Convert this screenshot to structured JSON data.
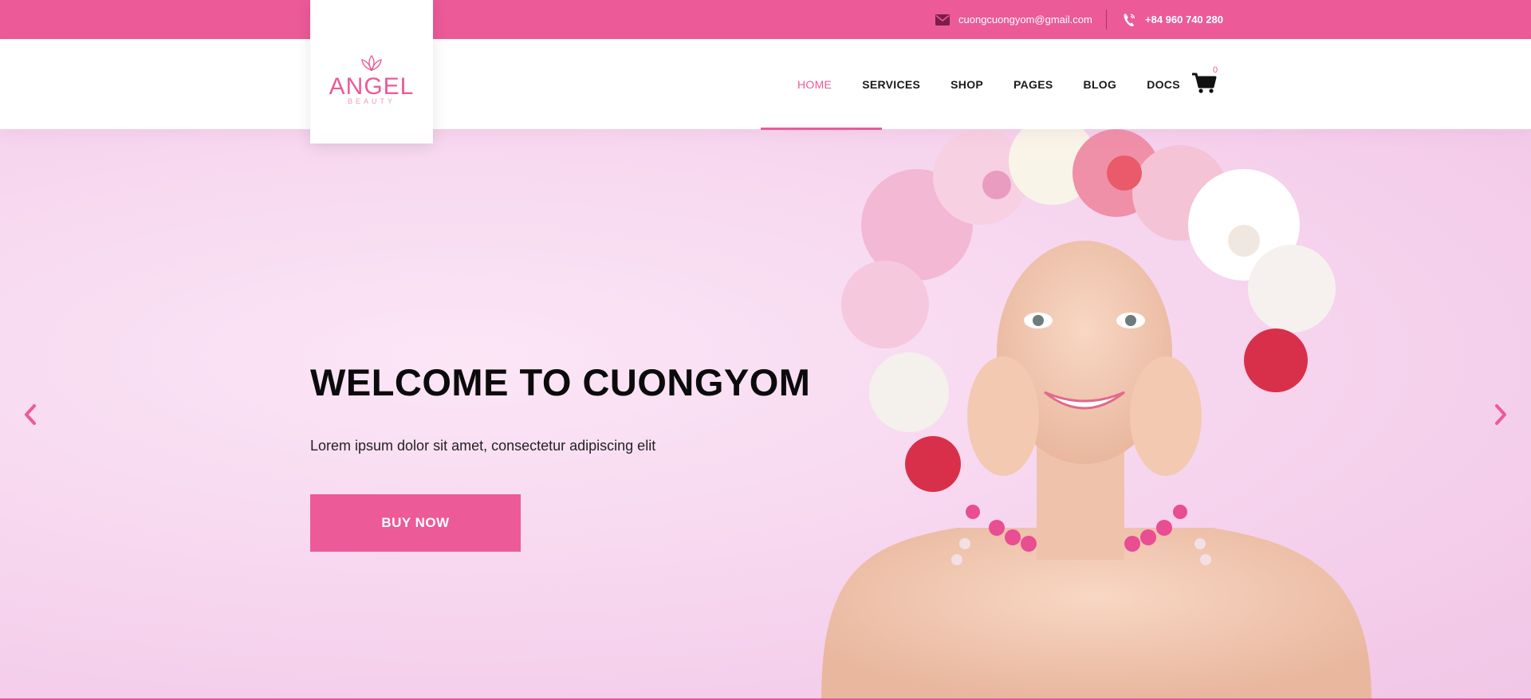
{
  "topbar": {
    "email": "cuongcuongyom@gmail.com",
    "phone": "+84 960 740 280",
    "email_icon": "envelope-icon",
    "phone_icon": "phone-icon"
  },
  "logo": {
    "name": "ANGEL",
    "tagline": "BEAUTY",
    "icon": "lotus-icon"
  },
  "nav": {
    "items": [
      {
        "label": "HOME",
        "active": true
      },
      {
        "label": "SERVICES"
      },
      {
        "label": "SHOP"
      },
      {
        "label": "PAGES"
      },
      {
        "label": "BLOG"
      },
      {
        "label": "DOCS"
      }
    ],
    "cart_icon": "cart-icon",
    "cart_count": "0"
  },
  "hero": {
    "title": "WELCOME TO CUONGYOM",
    "subtitle": "Lorem ipsum dolor sit amet, consectetur adipiscing elit",
    "button_label": "BUY NOW",
    "prev_icon": "chevron-left-icon",
    "next_icon": "chevron-right-icon"
  },
  "colors": {
    "accent": "#ec5a98",
    "hero_bg": "#f6d4ee",
    "text_dark": "#0b0b0b"
  }
}
